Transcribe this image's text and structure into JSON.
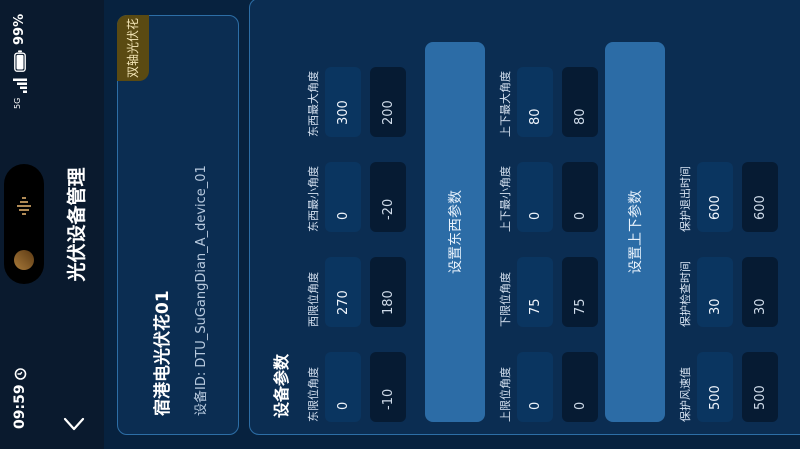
{
  "status_bar": {
    "time": "09:59",
    "network": "5G",
    "battery": "99%",
    "icons": [
      "alarm-icon",
      "signal-icon",
      "battery-icon"
    ]
  },
  "header": {
    "title": "光伏设备管理",
    "back_icon": "chevron-left-icon"
  },
  "device": {
    "name": "宿港电光伏花01",
    "id": "设备ID: DTU_SuGangDian_A_device_01",
    "type_badge": "双轴光伏花"
  },
  "settings": {
    "title": "设备参数",
    "ew": {
      "fields": [
        {
          "label": "东限位角度",
          "value": "0",
          "current": "-10"
        },
        {
          "label": "西限位角度",
          "value": "270",
          "current": "180"
        },
        {
          "label": "东西最小角度",
          "value": "0",
          "current": "-20"
        },
        {
          "label": "东西最大角度",
          "value": "300",
          "current": "200"
        }
      ],
      "button": "设置东西参数"
    },
    "ud": {
      "fields": [
        {
          "label": "上限位角度",
          "value": "0",
          "current": "0"
        },
        {
          "label": "下限位角度",
          "value": "75",
          "current": "75"
        },
        {
          "label": "上下最小角度",
          "value": "0",
          "current": "0"
        },
        {
          "label": "上下最大角度",
          "value": "80",
          "current": "80"
        }
      ],
      "button": "设置上下参数"
    },
    "protect": {
      "fields": [
        {
          "label": "保护风速值",
          "value": "500",
          "current": "500"
        },
        {
          "label": "保护检查时间",
          "value": "30",
          "current": "30"
        },
        {
          "label": "保护退出时间",
          "value": "600",
          "current": "600"
        }
      ]
    }
  },
  "colors": {
    "background": "#07223f",
    "card": "#0b2d52",
    "card_border": "#2d6ea6",
    "button": "#2c6ca6",
    "badge": "#5a4a12"
  }
}
